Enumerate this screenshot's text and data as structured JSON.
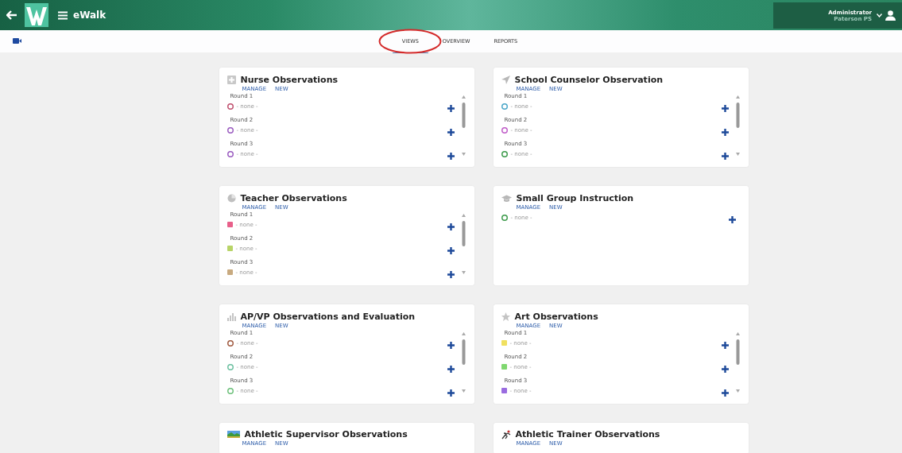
{
  "app": {
    "title": "eWalk"
  },
  "user": {
    "name": "Administrator",
    "school": "Paterson PS"
  },
  "tabs": [
    {
      "label": "VIEWS",
      "selected": true
    },
    {
      "label": "OVERVIEW",
      "selected": false
    },
    {
      "label": "REPORTS",
      "selected": false
    }
  ],
  "cards": [
    {
      "title": "Nurse Observations",
      "links": [
        "MANAGE",
        "NEW"
      ],
      "rounds": [
        {
          "label": "Round 1",
          "kind": "circle",
          "color": "#c0506e",
          "value": "- none -"
        },
        {
          "label": "Round 2",
          "kind": "circle",
          "color": "#9a5cc0",
          "value": "- none -"
        },
        {
          "label": "Round 3",
          "kind": "circle",
          "color": "#9a5cc0",
          "value": "- none -"
        }
      ]
    },
    {
      "title": "School Counselor Observation",
      "links": [
        "MANAGE",
        "NEW"
      ],
      "rounds": [
        {
          "label": "Round 1",
          "kind": "circle",
          "color": "#4aa6c8",
          "value": "- none -"
        },
        {
          "label": "Round 2",
          "kind": "circle",
          "color": "#c05cc8",
          "value": "- none -"
        },
        {
          "label": "Round 3",
          "kind": "circle",
          "color": "#3c9a4a",
          "value": "- none -"
        }
      ]
    },
    {
      "title": "Teacher Observations",
      "links": [
        "MANAGE",
        "NEW"
      ],
      "rounds": [
        {
          "label": "Round 1",
          "kind": "calendar",
          "color": "#e8608a",
          "value": "- none -"
        },
        {
          "label": "Round 2",
          "kind": "calendar",
          "color": "#b8d468",
          "value": "- none -"
        },
        {
          "label": "Round 3",
          "kind": "calendar",
          "color": "#c8aa80",
          "value": "- none -"
        }
      ]
    },
    {
      "title": "Small Group Instruction",
      "links": [
        "MANAGE",
        "NEW"
      ],
      "rounds": [
        {
          "kind": "circle",
          "color": "#3c9a4a",
          "value": "- none -"
        }
      ]
    },
    {
      "title": "AP/VP Observations and Evaluation",
      "links": [
        "MANAGE",
        "NEW"
      ],
      "rounds": [
        {
          "label": "Round 1",
          "kind": "circle",
          "color": "#a05a40",
          "value": "- none -"
        },
        {
          "label": "Round 2",
          "kind": "circle",
          "color": "#6cc0a0",
          "value": "- none -"
        },
        {
          "label": "Round 3",
          "kind": "circle",
          "color": "#6cc07a",
          "value": "- none -"
        }
      ]
    },
    {
      "title": "Art Observations",
      "links": [
        "MANAGE",
        "NEW"
      ],
      "rounds": [
        {
          "label": "Round 1",
          "kind": "calendar",
          "color": "#f0e060",
          "value": "- none -"
        },
        {
          "label": "Round 2",
          "kind": "calendar",
          "color": "#80d870",
          "value": "- none -"
        },
        {
          "label": "Round 3",
          "kind": "calendar",
          "color": "#9a6ce0",
          "value": "- none -"
        }
      ]
    },
    {
      "title": "Athletic Supervisor Observations",
      "links": [
        "MANAGE",
        "NEW"
      ]
    },
    {
      "title": "Athletic Trainer Observations",
      "links": [
        "MANAGE",
        "NEW"
      ]
    }
  ]
}
